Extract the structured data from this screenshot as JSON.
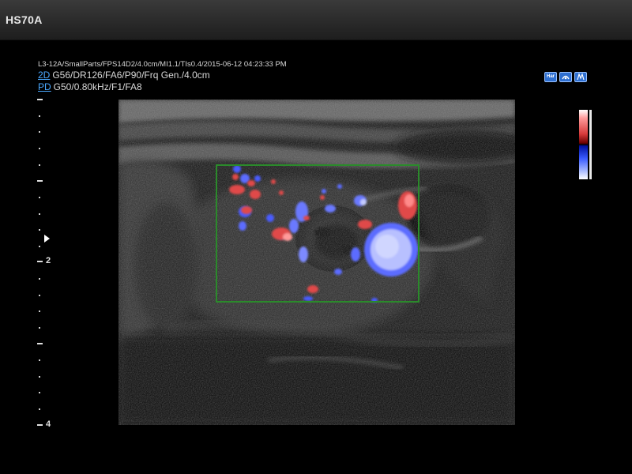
{
  "header": {
    "device_name": "HS70A"
  },
  "scan_info": {
    "probe_line": "L3-12A/SmallParts/FPS14D2/4.0cm/MI1.1/TIs0.4/2015-06-12 04:23:33 PM",
    "mode_2d": {
      "tag": "2D",
      "params": "G56/DR126/FA6/P90/Frq Gen./4.0cm"
    },
    "mode_pd": {
      "tag": "PD",
      "params": "G50/0.80kHz/F1/FA8"
    }
  },
  "depth_scale": {
    "labels": [
      "2",
      "4"
    ]
  },
  "icons": {
    "top_right": [
      "harmonic-icon",
      "probe-icon",
      "pd-mode-icon"
    ],
    "icon_texts": [
      "Har",
      "",
      ""
    ]
  },
  "colors": {
    "accent_mode": "#4aa8ff",
    "roi_box": "#2b8a2b",
    "doppler_red": "#e04a4a",
    "doppler_blue": "#5b6cff"
  }
}
